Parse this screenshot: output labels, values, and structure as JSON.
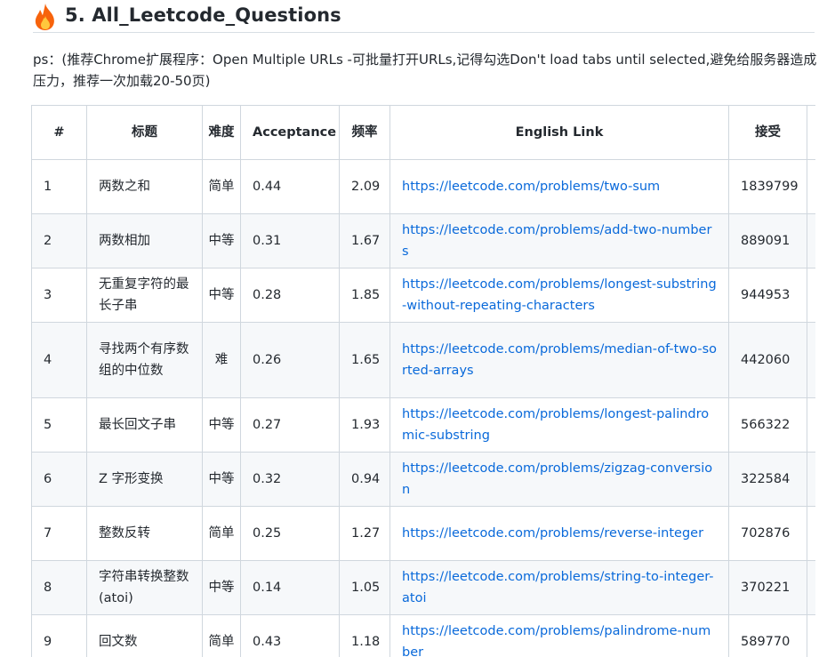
{
  "heading": {
    "text": "5. All_Leetcode_Questions",
    "icon": "fire-icon"
  },
  "note": "ps：(推荐Chrome扩展程序：Open Multiple URLs -可批量打开URLs,记得勾选Don't load tabs until selected,避免给服务器造成压力，推荐一次加载20-50页)",
  "table": {
    "headers": [
      "#",
      "标题",
      "难度",
      "Acceptance",
      "频率",
      "English Link",
      "接受",
      ""
    ],
    "rows": [
      {
        "id": "1",
        "title": "两数之和",
        "difficulty": "简单",
        "acceptance": "0.44",
        "frequency": "2.09",
        "link": "https://leetcode.com/problems/two-sum",
        "accepted": "1839799"
      },
      {
        "id": "2",
        "title": "两数相加",
        "difficulty": "中等",
        "acceptance": "0.31",
        "frequency": "1.67",
        "link": "https://leetcode.com/problems/add-two-numbers",
        "accepted": "889091"
      },
      {
        "id": "3",
        "title": "无重复字符的最长子串",
        "difficulty": "中等",
        "acceptance": "0.28",
        "frequency": "1.85",
        "link": "https://leetcode.com/problems/longest-substring-without-repeating-characters",
        "accepted": "944953"
      },
      {
        "id": "4",
        "title": "寻找两个有序数组的中位数",
        "difficulty": "难",
        "acceptance": "0.26",
        "frequency": "1.65",
        "link": "https://leetcode.com/problems/median-of-two-sorted-arrays",
        "accepted": "442060"
      },
      {
        "id": "5",
        "title": "最长回文子串",
        "difficulty": "中等",
        "acceptance": "0.27",
        "frequency": "1.93",
        "link": "https://leetcode.com/problems/longest-palindromic-substring",
        "accepted": "566322"
      },
      {
        "id": "6",
        "title": "Z 字形变换",
        "difficulty": "中等",
        "acceptance": "0.32",
        "frequency": "0.94",
        "link": "https://leetcode.com/problems/zigzag-conversion",
        "accepted": "322584"
      },
      {
        "id": "7",
        "title": "整数反转",
        "difficulty": "简单",
        "acceptance": "0.25",
        "frequency": "1.27",
        "link": "https://leetcode.com/problems/reverse-integer",
        "accepted": "702876"
      },
      {
        "id": "8",
        "title": "字符串转换整数 (atoi)",
        "difficulty": "中等",
        "acceptance": "0.14",
        "frequency": "1.05",
        "link": "https://leetcode.com/problems/string-to-integer-atoi",
        "accepted": "370221"
      },
      {
        "id": "9",
        "title": "回文数",
        "difficulty": "简单",
        "acceptance": "0.43",
        "frequency": "1.18",
        "link": "https://leetcode.com/problems/palindrome-number",
        "accepted": "589770"
      }
    ]
  }
}
